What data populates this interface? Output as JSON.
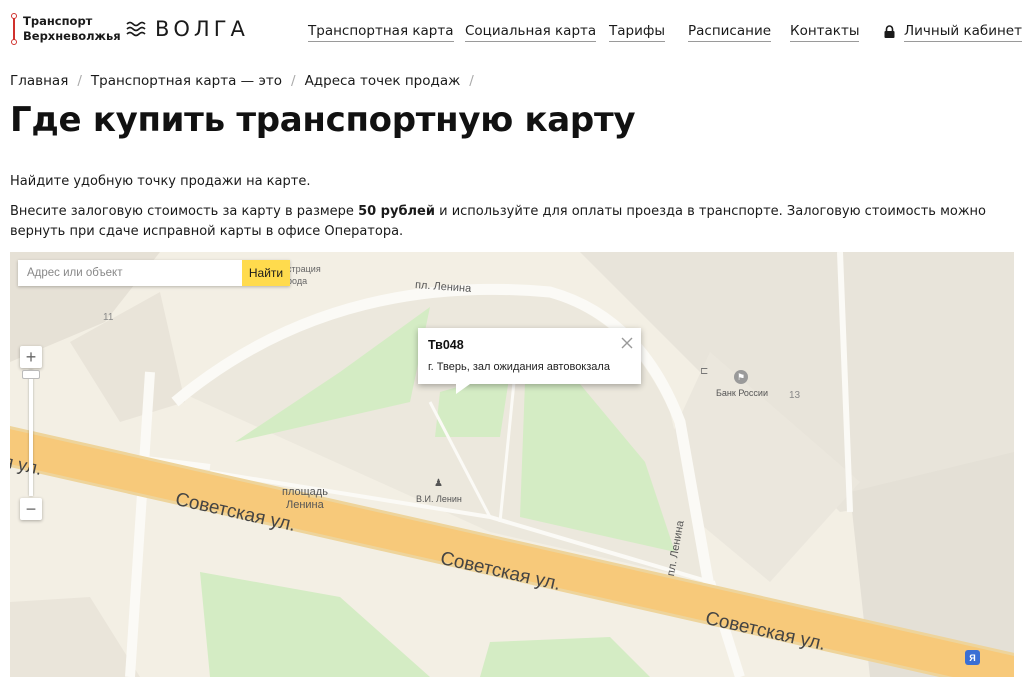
{
  "header": {
    "logo_line1": "Транспорт",
    "logo_line2": "Верхневолжья",
    "brand": "ВОЛГА",
    "nav": [
      {
        "label": "Транспортная карта"
      },
      {
        "label": "Социальная карта"
      },
      {
        "label": "Тарифы"
      },
      {
        "label": "Расписание"
      },
      {
        "label": "Контакты"
      },
      {
        "label": "Личный кабинет",
        "icon": "lock-icon"
      }
    ]
  },
  "breadcrumb": [
    {
      "label": "Главная"
    },
    {
      "label": "Транспортная карта — это"
    },
    {
      "label": "Адреса точек продаж"
    }
  ],
  "page": {
    "title": "Где купить транспортную карту",
    "intro": "Найдите удобную точку продажи на карте.",
    "deposit_before": "Внесите залоговую стоимость за карту в размере ",
    "deposit_amount": "50 рублей",
    "deposit_after": " и используйте для оплаты проезда в транспорте. Залоговую стоимость можно вернуть при сдаче исправной карты в офисе Оператора."
  },
  "map": {
    "search_placeholder": "Адрес или объект",
    "search_button": "Найти",
    "zoom_in": "+",
    "zoom_out": "−",
    "balloon_title": "Тв048",
    "balloon_text": "г. Тверь, зал ожидания автовокзала",
    "labels": {
      "square_top": "пл. Ленина",
      "square_right": "пл. Ленина",
      "square_name_1": "площадь",
      "square_name_2": "Ленина",
      "monument": "В.И. Ленин",
      "bank": "Банк России",
      "street_1": "Советская ул.",
      "street_2": "Советская ул.",
      "street_3": "Советская ул.",
      "street_left": "я ул.",
      "admin_1": "страция",
      "admin_2": "рода",
      "house_11": "11",
      "house_13": "13"
    },
    "traffic_badge": "Я"
  },
  "colors": {
    "accent_red": "#d0312d",
    "search_button": "#ffdb4d",
    "road": "#f7c97a",
    "park": "#d4ecc4"
  }
}
